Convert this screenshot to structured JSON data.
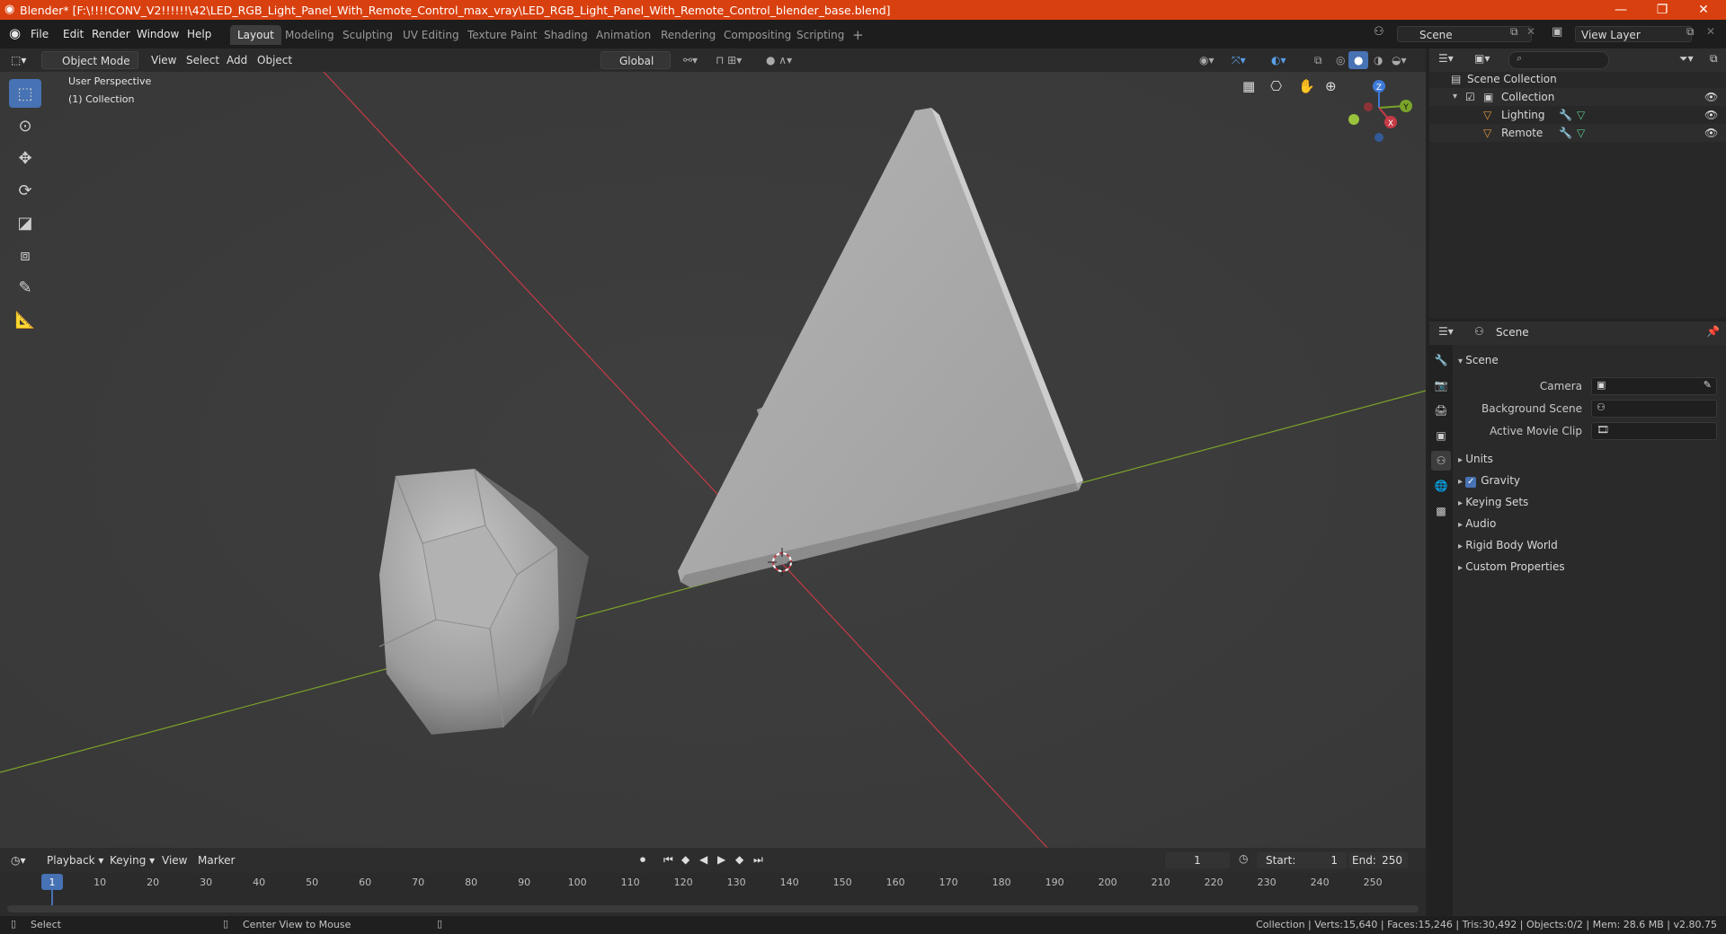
{
  "window": {
    "title": "Blender* [F:\\!!!!CONV_V2!!!!!!\\42\\LED_RGB_Light_Panel_With_Remote_Control_max_vray\\LED_RGB_Light_Panel_With_Remote_Control_blender_base.blend]",
    "minimize": "—",
    "maximize": "❐",
    "close": "✕"
  },
  "menu": {
    "file": "File",
    "edit": "Edit",
    "render": "Render",
    "window": "Window",
    "help": "Help"
  },
  "workspaces": [
    "Layout",
    "Modeling",
    "Sculpting",
    "UV Editing",
    "Texture Paint",
    "Shading",
    "Animation",
    "Rendering",
    "Compositing",
    "Scripting"
  ],
  "workspace_add": "+",
  "scene_field": "Scene",
  "view_layer_field": "View Layer",
  "viewport_header": {
    "mode": "Object Mode",
    "view": "View",
    "select": "Select",
    "add": "Add",
    "object": "Object",
    "orientation": "Global"
  },
  "viewport": {
    "perspective": "User Perspective",
    "collection": "(1) Collection",
    "gizmo": {
      "z": "Z",
      "y": "Y",
      "x": "X"
    }
  },
  "outliner": {
    "search_placeholder": "",
    "rows": [
      {
        "label": "Scene Collection"
      },
      {
        "label": "Collection"
      },
      {
        "label": "Lighting"
      },
      {
        "label": "Remote"
      }
    ]
  },
  "properties": {
    "header": "Scene",
    "section": "Scene",
    "camera_label": "Camera",
    "background_scene_label": "Background Scene",
    "active_movie_clip_label": "Active Movie Clip",
    "sections": [
      "Units",
      "Gravity",
      "Keying Sets",
      "Audio",
      "Rigid Body World",
      "Custom Properties"
    ],
    "gravity_checked": true
  },
  "timeline": {
    "playback": "Playback",
    "keying": "Keying",
    "view": "View",
    "marker": "Marker",
    "current_frame": "1",
    "start_label": "Start:",
    "start": "1",
    "end_label": "End:",
    "end": "250",
    "ticks": [
      "1",
      "10",
      "20",
      "30",
      "40",
      "50",
      "60",
      "70",
      "80",
      "90",
      "100",
      "110",
      "120",
      "130",
      "140",
      "150",
      "160",
      "170",
      "180",
      "190",
      "200",
      "210",
      "220",
      "230",
      "240",
      "250"
    ]
  },
  "status": {
    "select": "Select",
    "center_view": "Center View to Mouse",
    "stats": "Collection | Verts:15,640 | Faces:15,246 | Tris:30,492 | Objects:0/2 | Mem: 28.6 MB | v2.80.75"
  },
  "colors": {
    "titlebar": "#d9400f",
    "accent": "#4772b3",
    "x_axis": "#c53a46",
    "y_axis": "#7aa32a",
    "object_orange": "#e89a3c"
  }
}
